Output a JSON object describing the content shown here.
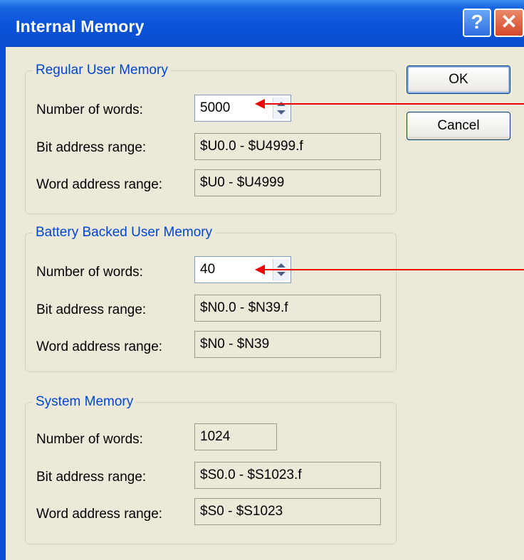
{
  "window": {
    "title": "Internal Memory",
    "help_label": "?",
    "close_label": "✕"
  },
  "buttons": {
    "ok_label": "OK",
    "cancel_label": "Cancel"
  },
  "groups": {
    "regular": {
      "title": "Regular User Memory",
      "words_label": "Number of words:",
      "words_value": "5000",
      "bit_label": "Bit address range:",
      "bit_value": "$U0.0 - $U4999.f",
      "word_label": "Word address range:",
      "word_value": "$U0 - $U4999"
    },
    "battery": {
      "title": "Battery Backed User Memory",
      "words_label": "Number of words:",
      "words_value": "40",
      "bit_label": "Bit address range:",
      "bit_value": "$N0.0 - $N39.f",
      "word_label": "Word address range:",
      "word_value": "$N0 - $N39"
    },
    "system": {
      "title": "System Memory",
      "words_label": "Number of words:",
      "words_value": "1024",
      "bit_label": "Bit address range:",
      "bit_value": "$S0.0 - $S1023.f",
      "word_label": "Word address range:",
      "word_value": "$S0 - $S1023"
    }
  },
  "colors": {
    "title_bar": "#0a4ed0",
    "group_title": "#0046d5",
    "annotation_arrow": "#ee0000"
  }
}
